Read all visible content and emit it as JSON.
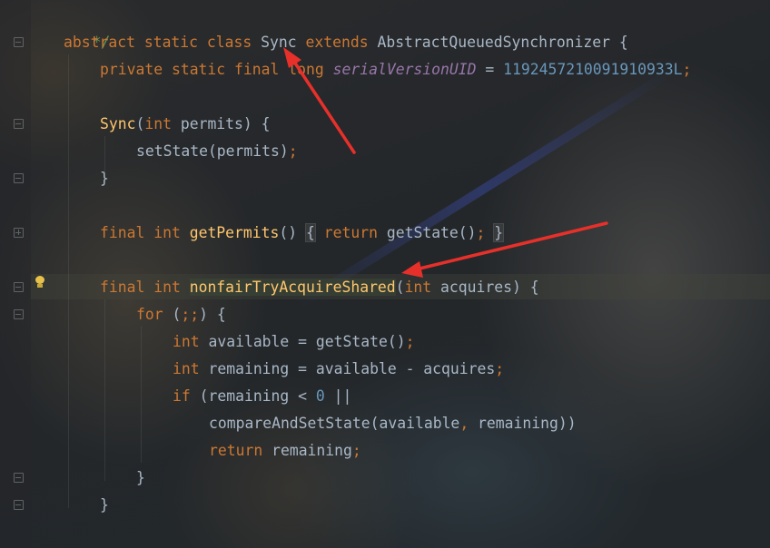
{
  "editor": {
    "lines": {
      "l1": {
        "comment": "*/"
      },
      "l2": {
        "kw1": "abstract",
        "kw2": "static",
        "kw3": "class",
        "name": "Sync",
        "kw4": "extends",
        "parent": "AbstractQueuedSynchronizer",
        "brace": "{"
      },
      "l3": {
        "kw1": "private",
        "kw2": "static",
        "kw3": "final",
        "type": "long",
        "field": "serialVersionUID",
        "eq": " = ",
        "value": "1192457210091910933L",
        "semi": ";"
      },
      "l4": {
        "ctor": "Sync",
        "open": "(",
        "type": "int",
        "param": " permits",
        "close": ") {"
      },
      "l5": {
        "call": "setState(permits)",
        "semi": ";"
      },
      "l6": {
        "brace": "}"
      },
      "l7": {
        "kw1": "final",
        "kw2": "int",
        "name": "getPermits",
        "parens": "()",
        "open": "{",
        "kw3": "return",
        "call": " getState()",
        "semi": ";",
        "close": "}"
      },
      "l8": {
        "kw1": "final",
        "kw2": "int",
        "name": "nonfairTryAcquireShared",
        "open": "(",
        "type": "int",
        "param": " acquires) {"
      },
      "l9": {
        "kw": "for",
        "cond": " (",
        "semis": ";;",
        "rest": ") {"
      },
      "l10": {
        "type": "int",
        "text": " available = getState()",
        "semi": ";"
      },
      "l11": {
        "type": "int",
        "text": " remaining = available - acquires",
        "semi": ";"
      },
      "l12": {
        "kw": "if",
        "text": " (remaining < ",
        "num": "0",
        "rest": " ||"
      },
      "l13": {
        "call": "compareAndSetState(available",
        "comma": ",",
        "rest": " remaining))"
      },
      "l14": {
        "kw": "return",
        "text": " remaining",
        "semi": ";"
      },
      "l15": {
        "brace": "}"
      },
      "l16": {
        "brace": "}"
      }
    }
  },
  "colors": {
    "keyword": "#cc7832",
    "method": "#ffc66d",
    "number": "#6897bb",
    "comment": "#629755",
    "static_field": "#9876aa",
    "plain": "#a9b7c6",
    "annotation_arrow": "#e8302a"
  },
  "icons": {
    "gutter_fold": "fold-marker-icon",
    "intention": "lightbulb-icon"
  }
}
